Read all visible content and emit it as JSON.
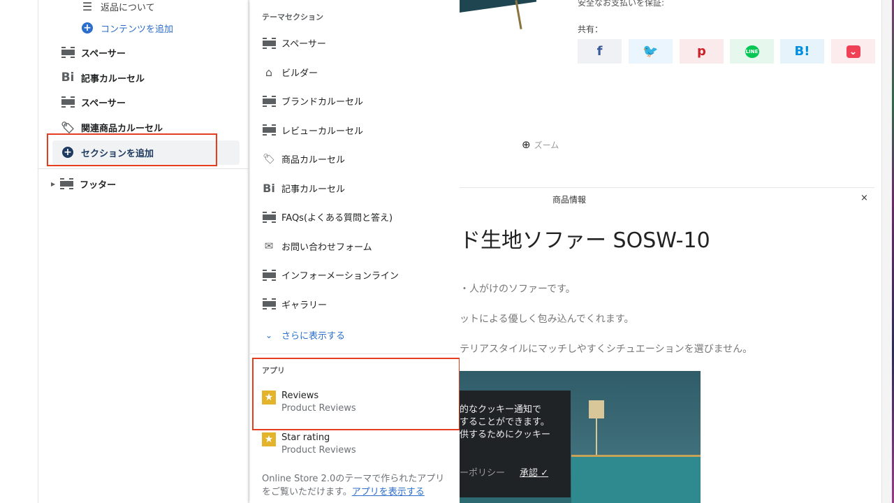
{
  "sidebar": {
    "items": [
      {
        "label": "返品について",
        "icon": "text-lines-icon"
      },
      {
        "label": "コンテンツを追加",
        "icon": "plus-circle-icon"
      },
      {
        "label": "スペーサー",
        "icon": "spacer-icon"
      },
      {
        "label": "記事カルーセル",
        "icon": "blog-icon"
      },
      {
        "label": "スペーサー",
        "icon": "spacer-icon"
      },
      {
        "label": "関連商品カルーセル",
        "icon": "tag-icon"
      },
      {
        "label": "セクションを追加",
        "icon": "plus-circle-icon"
      },
      {
        "label": "フッター",
        "icon": "spacer-icon"
      }
    ]
  },
  "popup": {
    "theme_heading": "テーマセクション",
    "sections": [
      {
        "label": "スペーサー",
        "icon": "spacer-icon"
      },
      {
        "label": "ビルダー",
        "icon": "home-icon"
      },
      {
        "label": "ブランドカルーセル",
        "icon": "spacer-icon"
      },
      {
        "label": "レビューカルーセル",
        "icon": "spacer-icon"
      },
      {
        "label": "商品カルーセル",
        "icon": "tag-icon"
      },
      {
        "label": "記事カルーセル",
        "icon": "blog-icon"
      },
      {
        "label": "FAQs(よくある質問と答え)",
        "icon": "spacer-icon"
      },
      {
        "label": "お問い合わせフォーム",
        "icon": "mail-icon"
      },
      {
        "label": "インフォーメーションライン",
        "icon": "spacer-icon"
      },
      {
        "label": "ギャラリー",
        "icon": "spacer-icon"
      }
    ],
    "show_more": "さらに表示する",
    "apps_heading": "アプリ",
    "apps": [
      {
        "name": "Reviews",
        "provider": "Product Reviews",
        "icon": "star-icon"
      },
      {
        "name": "Star rating",
        "provider": "Product Reviews",
        "icon": "star-icon"
      }
    ],
    "footer_text": "Online Store 2.0のテーマで作られたアプリをご覧いただけます。",
    "footer_link": "アプリを表示する"
  },
  "preview": {
    "secure_payment": "安全なお支払いを保証:",
    "share_label": "共有：",
    "share_buttons": [
      {
        "name": "facebook",
        "glyph": "f",
        "color": "#3b5998",
        "bg": "#f0f1f5"
      },
      {
        "name": "twitter",
        "glyph": "🐦",
        "color": "#1da1f2",
        "bg": "#eaf5fd"
      },
      {
        "name": "pinterest",
        "glyph": "p",
        "color": "#cb2027",
        "bg": "#fbeaeb"
      },
      {
        "name": "line",
        "glyph": "LINE",
        "color": "#06c755",
        "bg": "#e6f8ee"
      },
      {
        "name": "hatena",
        "glyph": "B!",
        "color": "#008fde",
        "bg": "#e6f3fb"
      },
      {
        "name": "pocket",
        "glyph": "⌄",
        "color": "#ef4056",
        "bg": "#fdeced"
      }
    ],
    "zoom_label": "ズーム",
    "tab_label": "商品情報",
    "close": "×",
    "title": "ド生地ソファー SOSW-10",
    "paragraphs": [
      "・人がけのソファーです。",
      "ットによる優しく包み込んでくれます。",
      "テリアスタイルにマッチしやすくシチュエーションを選びません。"
    ],
    "cookie_lines": [
      "的なクッキー通知で",
      "することができます。",
      "供するためにクッキー"
    ],
    "cookie_policy": "ーポリシー",
    "cookie_accept": "承認"
  },
  "colors": {
    "highlight": "#e53d20",
    "link": "#2c6ecb",
    "star": "#e2b32b"
  }
}
